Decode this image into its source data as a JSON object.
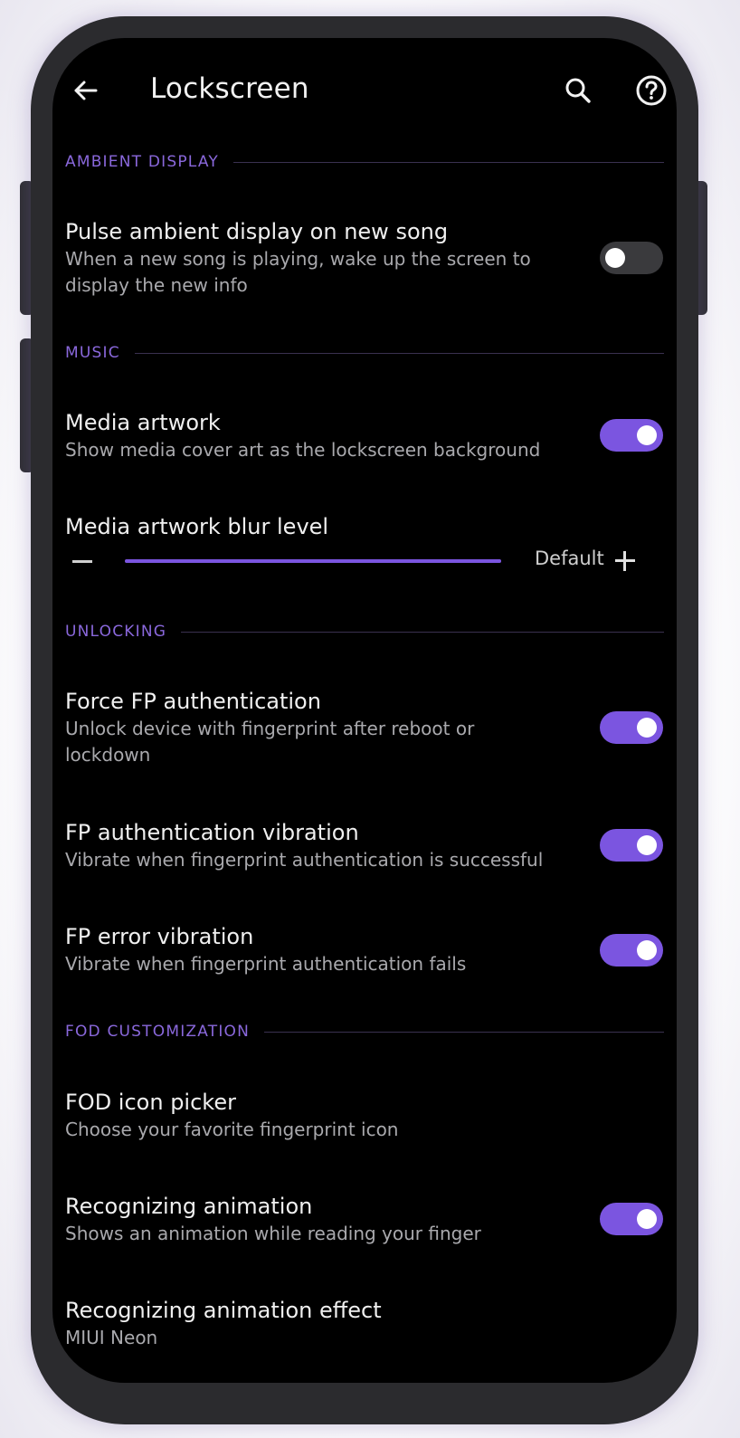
{
  "colors": {
    "accent": "#7b55e0",
    "section_label": "#8a68dc",
    "background": "#000000",
    "frame": "#2b2b2e"
  },
  "appbar": {
    "back_icon": "arrow-left-icon",
    "title": "Lockscreen",
    "search_icon": "search-icon",
    "help_icon": "help-circle-icon"
  },
  "sections": {
    "ambient": "AMBIENT DISPLAY",
    "music": "MUSIC",
    "unlocking": "UNLOCKING",
    "fod": "FOD CUSTOMIZATION"
  },
  "prefs": {
    "pulse": {
      "title": "Pulse ambient display on new song",
      "summary": "When a new song is playing, wake up the screen to display the new info",
      "checked": false
    },
    "media_artwork": {
      "title": "Media artwork",
      "summary": "Show media cover art as the lockscreen background",
      "checked": true
    },
    "blur": {
      "title": "Media artwork blur level",
      "value_label": "Default",
      "level_fraction": 1.0
    },
    "force_fp": {
      "title": "Force FP authentication",
      "summary": "Unlock device with fingerprint after reboot or lockdown",
      "checked": true
    },
    "fp_auth_vibration": {
      "title": "FP authentication vibration",
      "summary": "Vibrate when fingerprint authentication is successful",
      "checked": true
    },
    "fp_error_vibration": {
      "title": "FP error vibration",
      "summary": "Vibrate when fingerprint authentication fails",
      "checked": true
    },
    "fod_icon_picker": {
      "title": "FOD icon picker",
      "summary": "Choose your favorite fingerprint icon"
    },
    "recognizing_animation": {
      "title": "Recognizing animation",
      "summary": "Shows an animation while reading your finger",
      "checked": true
    },
    "recognizing_effect": {
      "title": "Recognizing animation effect",
      "summary": "MIUI Neon"
    }
  }
}
